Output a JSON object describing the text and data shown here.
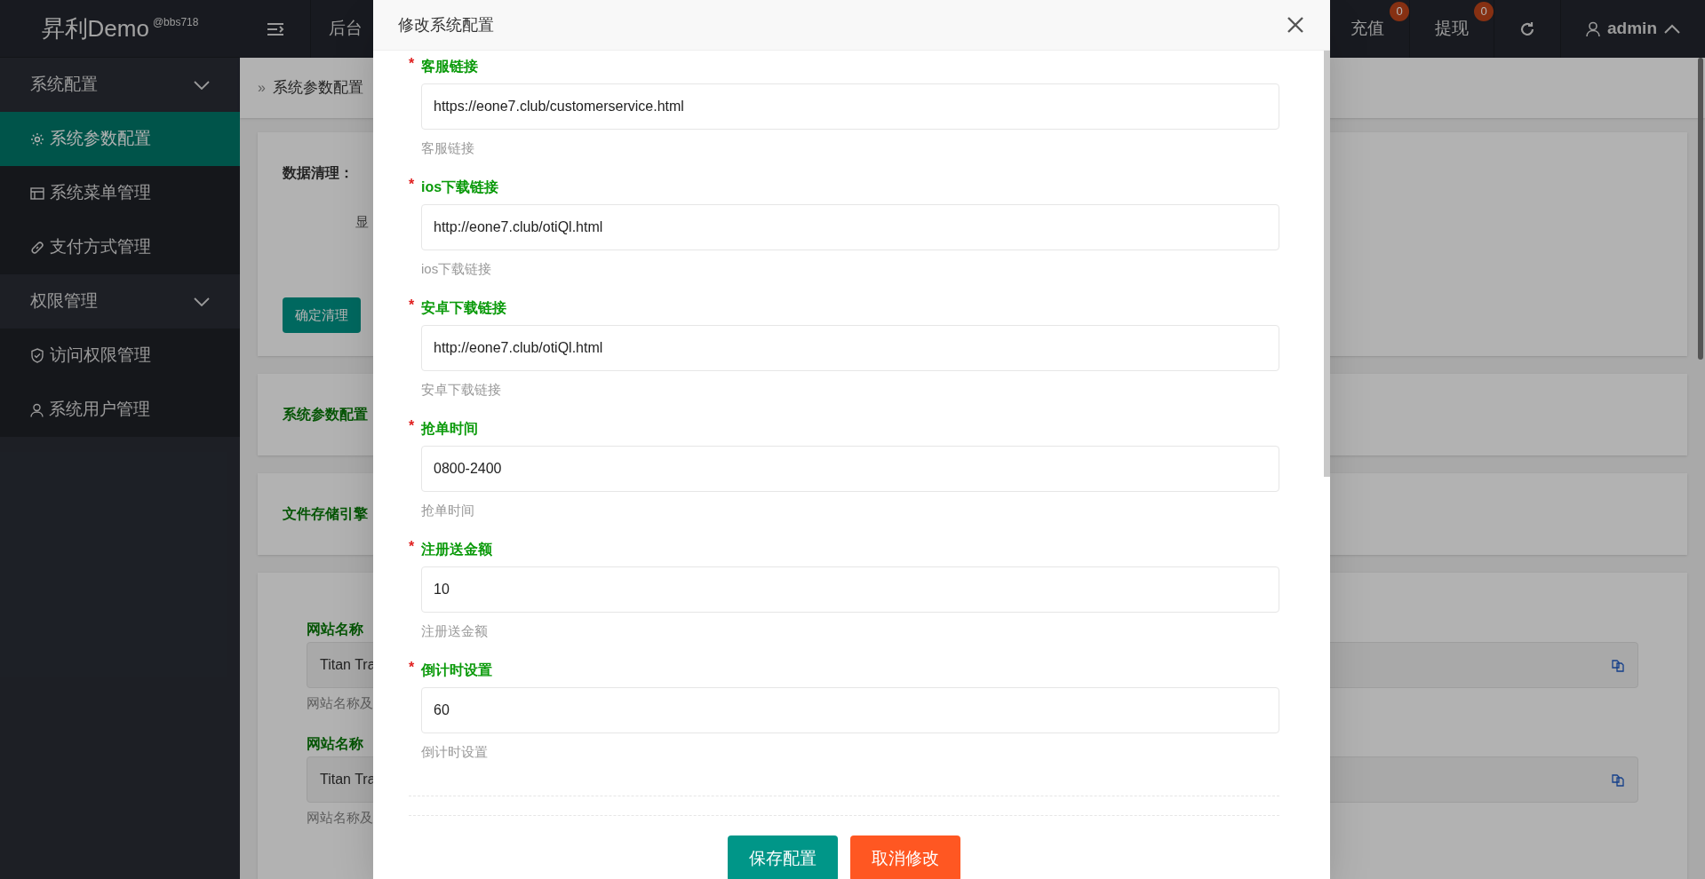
{
  "header": {
    "logo": "昇利Demo",
    "logo_tag": "@bbs718",
    "nav_tab": "后台",
    "actions": [
      {
        "label": "充值",
        "badge": "0"
      },
      {
        "label": "提现",
        "badge": "0"
      }
    ],
    "user": "admin"
  },
  "sidebar": [
    {
      "label": "系统配置",
      "expanded": true,
      "children": [
        {
          "label": "系统参数配置",
          "selected": true
        },
        {
          "label": "系统菜单管理",
          "selected": false
        },
        {
          "label": "支付方式管理",
          "selected": false
        }
      ]
    },
    {
      "label": "权限管理",
      "expanded": true,
      "children": [
        {
          "label": "访问权限管理",
          "selected": false
        },
        {
          "label": "系统用户管理",
          "selected": false
        }
      ]
    }
  ],
  "breadcrumb": {
    "separator": "»",
    "label": "系统参数配置"
  },
  "cards": [
    {
      "kind": "clean",
      "title": "数据清理：",
      "note": "显",
      "button": "确定清理"
    },
    {
      "kind": "title",
      "title": "系统参数配置"
    },
    {
      "kind": "title",
      "title": "文件存储引擎"
    },
    {
      "kind": "fields",
      "fields": [
        {
          "label": "网站名称",
          "value": "Titan Tra",
          "help": "网站名称及"
        },
        {
          "label": "网站名称",
          "value": "Titan Tra",
          "help": "网站名称及"
        }
      ]
    }
  ],
  "modal": {
    "title": "修改系统配置",
    "fields": [
      {
        "label": "客服链接",
        "marker": "*",
        "value": "https://eone7.club/customerservice.html",
        "help": "客服链接"
      },
      {
        "label": "ios下载链接",
        "marker": "*",
        "value": "http://eone7.club/otiQl.html",
        "help": "ios下载链接"
      },
      {
        "label": "安卓下载链接",
        "marker": "*",
        "value": "http://eone7.club/otiQl.html",
        "help": "安卓下载链接"
      },
      {
        "label": "抢单时间",
        "marker": "*",
        "value": "0800-2400",
        "help": "抢单时间"
      },
      {
        "label": "注册送金额",
        "marker": "*",
        "value": "10",
        "help": "注册送金额"
      },
      {
        "label": "倒计时设置",
        "marker": "*",
        "value": "60",
        "help": "倒计时设置"
      }
    ],
    "buttons": [
      {
        "label": "保存配置",
        "kind": "primary"
      },
      {
        "label": "取消修改",
        "kind": "danger"
      }
    ]
  }
}
